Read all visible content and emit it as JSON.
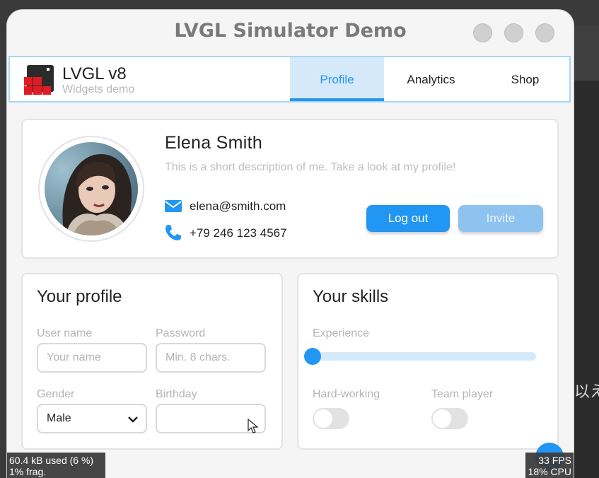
{
  "window": {
    "title": "LVGL Simulator Demo"
  },
  "header": {
    "app_title": "LVGL v8",
    "app_subtitle": "Widgets demo",
    "tabs": [
      {
        "label": "Profile",
        "active": true
      },
      {
        "label": "Analytics",
        "active": false
      },
      {
        "label": "Shop",
        "active": false
      }
    ]
  },
  "profile_card": {
    "name": "Elena Smith",
    "description": "This is a short description of me. Take a look at my profile!",
    "email": "elena@smith.com",
    "phone": "+79 246 123 4567",
    "logout_label": "Log out",
    "invite_label": "Invite",
    "icons": {
      "email": "envelope-icon",
      "phone": "phone-icon"
    }
  },
  "your_profile": {
    "title": "Your profile",
    "username_label": "User name",
    "username_placeholder": "Your name",
    "password_label": "Password",
    "password_placeholder": "Min. 8 chars.",
    "gender_label": "Gender",
    "gender_value": "Male",
    "birthday_label": "Birthday",
    "birthday_value": ""
  },
  "your_skills": {
    "title": "Your skills",
    "experience_label": "Experience",
    "experience_value": 0,
    "hardworking_label": "Hard-working",
    "hardworking_on": false,
    "teamplayer_label": "Team player",
    "teamplayer_on": false
  },
  "overlay": {
    "mem_line1": "60.4 kB used (6 %)",
    "mem_line2": "1% frag.",
    "fps": "33 FPS",
    "cpu": "18% CPU"
  },
  "background": {
    "cjk_text": "以え"
  },
  "colors": {
    "accent": "#2196f3",
    "accent_light": "#d6e9fb",
    "disabled": "#8ec3ef"
  }
}
